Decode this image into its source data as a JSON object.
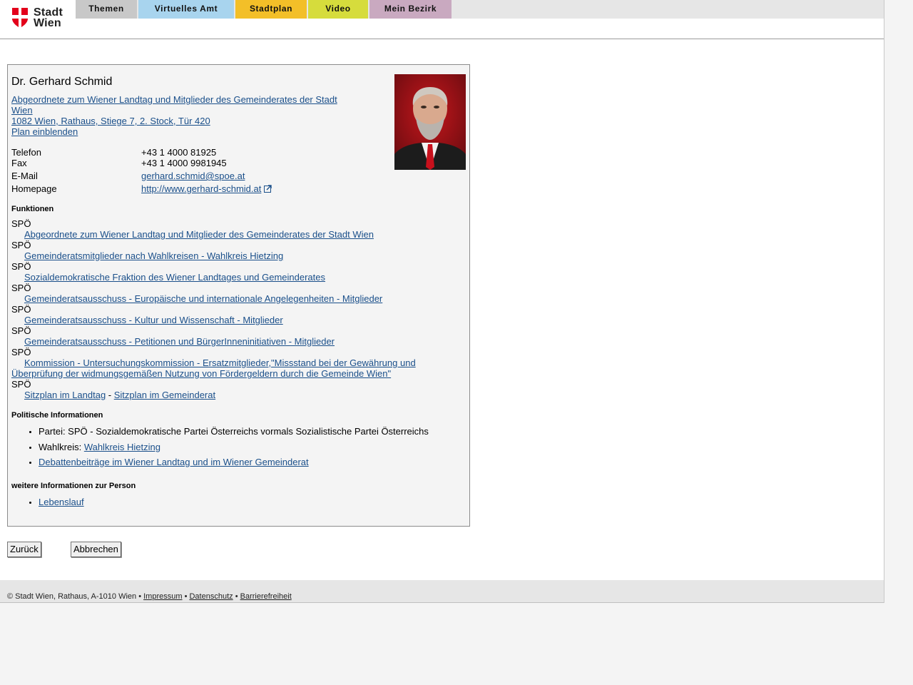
{
  "header": {
    "logo_line1": "Stadt",
    "logo_line2": "Wien",
    "tabs": [
      {
        "label": "Themen",
        "color": "#c8c8c8"
      },
      {
        "label": "Virtuelles Amt",
        "color": "#a8d4ee"
      },
      {
        "label": "Stadtplan",
        "color": "#f3bf28"
      },
      {
        "label": "Video",
        "color": "#d6dc3c"
      },
      {
        "label": "Mein Bezirk",
        "color": "#c9a9c0"
      }
    ]
  },
  "person": {
    "name": "Dr. Gerhard Schmid",
    "org_link_line1": "Abgeordnete zum Wiener Landtag und Mitglieder des Gemeinderates der Stadt",
    "org_link_line2": "Wien ",
    "address": "1082 Wien, Rathaus, Stiege 7, 2. Stock, Tür 420",
    "plan_link": "Plan einblenden"
  },
  "contact": {
    "phone_label": "Telefon",
    "phone": "+43 1 4000 81925",
    "fax_label": "Fax",
    "fax": "+43 1 4000 9981945",
    "email_label": "E-Mail",
    "email": "gerhard.schmid@spoe.at",
    "homepage_label": "Homepage",
    "homepage": "http://www.gerhard-schmid.at"
  },
  "functions": {
    "title": "Funktionen",
    "items": [
      {
        "party": "SPÖ",
        "link": "Abgeordnete zum Wiener Landtag und Mitglieder des Gemeinderates der Stadt Wien"
      },
      {
        "party": "SPÖ",
        "link": "Gemeinderatsmitglieder nach Wahlkreisen - Wahlkreis Hietzing"
      },
      {
        "party": "SPÖ",
        "link": "Sozialdemokratische Fraktion des Wiener Landtages und Gemeinderates"
      },
      {
        "party": "SPÖ",
        "link": "Gemeinderatsausschuss - Europäische und internationale Angelegenheiten - Mitglieder"
      },
      {
        "party": "SPÖ",
        "link": "Gemeinderatsausschuss - Kultur und Wissenschaft - Mitglieder"
      },
      {
        "party": "SPÖ",
        "link": "Gemeinderatsausschuss - Petitionen und BürgerInneninitiativen - Mitglieder"
      },
      {
        "party": "SPÖ",
        "link": "Kommission - Untersuchungskommission - Ersatzmitglieder,\"Missstand bei der Gewährung und Überprüfung der widmungsgemäßen Nutzung von Fördergeldern durch die Gemeinde Wien\""
      }
    ],
    "last_party": "SPÖ",
    "sitzplan_landtag": "Sitzplan im Landtag",
    "separator": " - ",
    "sitzplan_gemeinderat": "Sitzplan im Gemeinderat"
  },
  "political": {
    "title": "Politische Informationen",
    "party_text": "Partei: SPÖ - Sozialdemokratische Partei Österreichs vormals Sozialistische Partei Österreichs",
    "district_label": "Wahlkreis: ",
    "district_link": "Wahlkreis Hietzing",
    "debates_link": "Debattenbeiträge im Wiener Landtag und im Wiener Gemeinderat"
  },
  "more": {
    "title": "weitere Informationen zur Person",
    "cv_link": "Lebenslauf"
  },
  "buttons": {
    "back": "Zurück",
    "cancel": "Abbrechen"
  },
  "footer": {
    "copyright": "© Stadt Wien, Rathaus, A-1010 Wien • ",
    "impressum": "Impressum",
    "sep1": " • ",
    "datenschutz": "Datenschutz",
    "sep2": " • ",
    "barrierefreiheit": "Barrierefreiheit"
  }
}
